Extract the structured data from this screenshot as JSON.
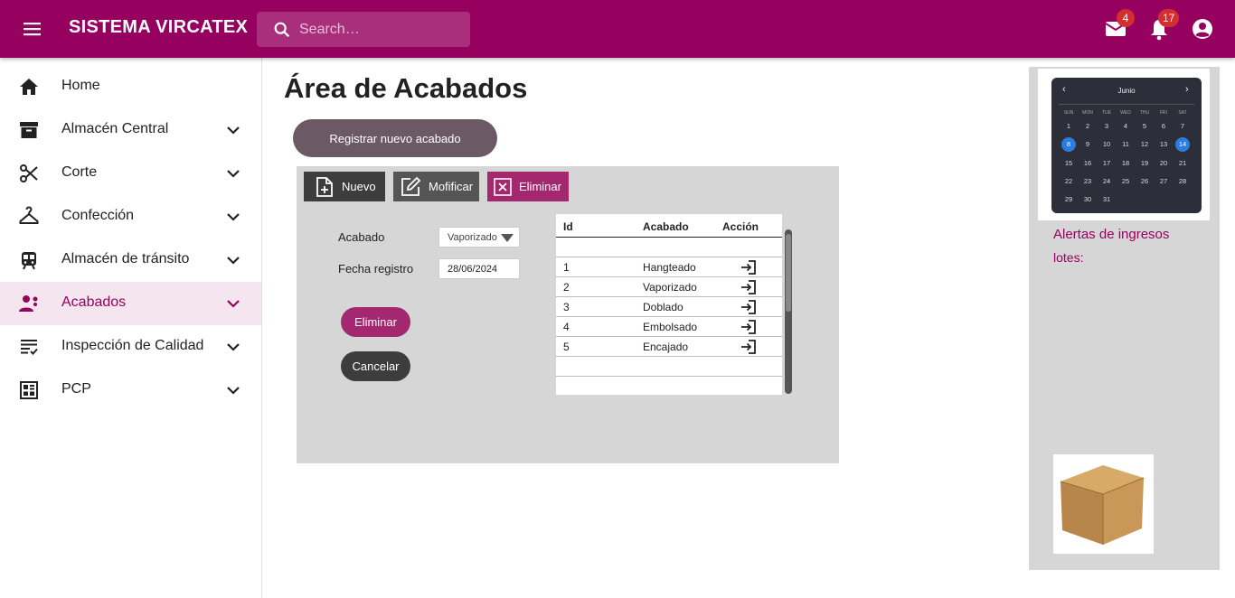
{
  "header": {
    "brand": "SISTEMA VIRCATEX",
    "search_placeholder": "Search…",
    "mail_badge": "4",
    "notifications_badge": "17",
    "color": "#96005f"
  },
  "sidebar": {
    "items": [
      {
        "label": "Home",
        "icon": "home-icon"
      },
      {
        "label": "Almacén Central",
        "icon": "archive-icon"
      },
      {
        "label": "Corte",
        "icon": "scissors-icon"
      },
      {
        "label": "Confección",
        "icon": "hanger-icon"
      },
      {
        "label": "Almacén de tránsito",
        "icon": "train-icon"
      },
      {
        "label": "Acabados",
        "icon": "worker-icon",
        "active": true
      },
      {
        "label": "Inspección de Calidad",
        "icon": "checklist-icon"
      },
      {
        "label": "PCP",
        "icon": "dashboard-icon"
      }
    ]
  },
  "main": {
    "title": "Área de Acabados",
    "register_button": "Registrar nuevo acabado",
    "toolbar": {
      "new_label": "Nuevo",
      "modify_label": "Mofificar",
      "delete_label": "Eliminar"
    },
    "form": {
      "acabado_label": "Acabado",
      "acabado_value": "Vaporizado",
      "fecha_label": "Fecha registro",
      "fecha_value": "28/06/2024",
      "delete_button": "Eliminar",
      "cancel_button": "Cancelar"
    },
    "table": {
      "headers": [
        "Id",
        "Acabado",
        "Acción"
      ],
      "rows": [
        {
          "id": "1",
          "acabado": "Hangteado"
        },
        {
          "id": "2",
          "acabado": "Vaporizado"
        },
        {
          "id": "3",
          "acabado": "Doblado"
        },
        {
          "id": "4",
          "acabado": "Embolsado"
        },
        {
          "id": "5",
          "acabado": "Encajado"
        }
      ]
    }
  },
  "right_panel": {
    "calendar": {
      "month": "Junio",
      "prev": "‹",
      "next": "›",
      "weekdays": [
        "SUN",
        "MON",
        "TUE",
        "WED",
        "THU",
        "FRI",
        "SAT"
      ],
      "days": [
        [
          "1",
          "2",
          "3",
          "4",
          "5",
          "6",
          "7"
        ],
        [
          "8",
          "9",
          "10",
          "11",
          "12",
          "13",
          "14"
        ],
        [
          "15",
          "16",
          "17",
          "18",
          "19",
          "20",
          "21"
        ],
        [
          "22",
          "23",
          "24",
          "25",
          "26",
          "27",
          "28"
        ],
        [
          "29",
          "30",
          "31",
          "",
          "",
          "",
          ""
        ]
      ],
      "selected": [
        "8",
        "14"
      ]
    },
    "alerts_title": "Alertas de ingresos",
    "alerts_sub": "lotes:"
  }
}
